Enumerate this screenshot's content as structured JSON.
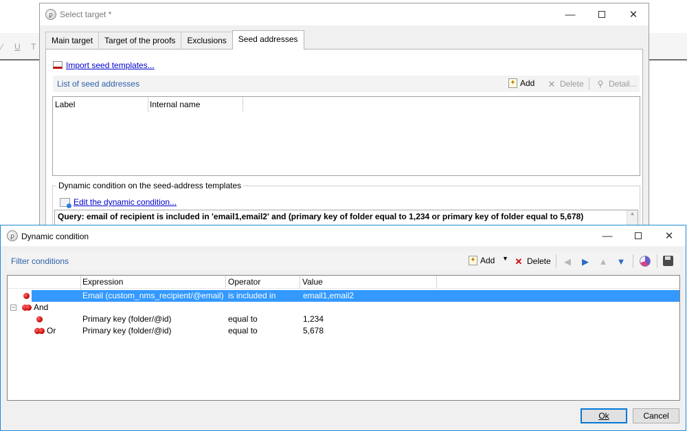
{
  "background": {
    "format_glyphs": [
      "⁄",
      "U",
      "T"
    ]
  },
  "select_target": {
    "title": "Select target *",
    "tabs": [
      {
        "label": "Main target",
        "active": false
      },
      {
        "label": "Target of the proofs",
        "active": false
      },
      {
        "label": "Exclusions",
        "active": false
      },
      {
        "label": "Seed addresses",
        "active": true
      }
    ],
    "import_link": "Import seed templates...",
    "list_title": "List of seed addresses",
    "toolbar": {
      "add": "Add",
      "delete": "Delete",
      "detail": "Detail..."
    },
    "columns": [
      "Label",
      "Internal name"
    ],
    "group_label": "Dynamic condition on the seed-address templates",
    "edit_link": "Edit the dynamic condition...",
    "query": "Query: email of recipient is included in 'email1,email2' and (primary key of folder equal to 1,234 or primary key of folder equal to 5,678)"
  },
  "dynamic_condition": {
    "title": "Dynamic condition",
    "filter_title": "Filter conditions",
    "toolbar": {
      "add": "Add",
      "delete": "Delete"
    },
    "columns": {
      "expression": "Expression",
      "operator": "Operator",
      "value": "Value"
    },
    "rows": [
      {
        "label": "",
        "expression": "Email (custom_nms_recipient/@email)",
        "operator": "is included in",
        "value": "email1,email2",
        "selected": true
      },
      {
        "label": "And",
        "expression": "",
        "operator": "",
        "value": "",
        "selected": false
      },
      {
        "label": "",
        "expression": "Primary key (folder/@id)",
        "operator": "equal to",
        "value": "1,234",
        "selected": false
      },
      {
        "label": "Or",
        "expression": "Primary key (folder/@id)",
        "operator": "equal to",
        "value": "5,678",
        "selected": false
      }
    ],
    "ok": "Ok",
    "cancel": "Cancel"
  },
  "colors": {
    "accent": "#3399ff",
    "link": "#0000cc",
    "section_title": "#2b5fa8",
    "delete_red": "#d00000"
  }
}
